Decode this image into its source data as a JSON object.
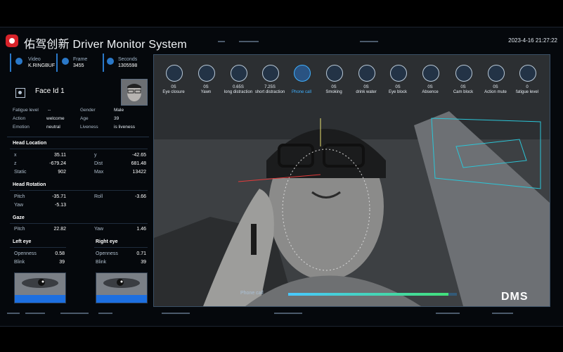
{
  "app": {
    "title": "佑驾创新 Driver  Monitor  System",
    "datetime": "2023-4-16 21:27:22"
  },
  "header": {
    "video_label": "Video",
    "video_value": "K.RINGBUF",
    "frame_label": "Frame",
    "frame_value": "3455",
    "seconds_label": "Seconds",
    "seconds_value": "1305598"
  },
  "face": {
    "title": "Face Id  1",
    "fields": [
      {
        "label": "Fatigue level",
        "value": "--"
      },
      {
        "label": "Action",
        "value": "welcome"
      },
      {
        "label": "Emotion",
        "value": "neutral"
      },
      {
        "label": "Gender",
        "value": "Male"
      },
      {
        "label": "Age",
        "value": "39"
      },
      {
        "label": "Liveness",
        "value": "is liveness"
      }
    ]
  },
  "head_location": {
    "title": "Head Location",
    "x_label": "x",
    "x": "35.11",
    "y_label": "y",
    "y": "-42.65",
    "z_label": "z",
    "z": "-679.24",
    "dist_label": "Dist",
    "dist": "681.48",
    "static_label": "Static",
    "static": "902",
    "max_label": "Max",
    "max": "13422"
  },
  "head_rotation": {
    "title": "Head Rotation",
    "pitch_label": "Pitch",
    "pitch": "-35.71",
    "roll_label": "Roll",
    "roll": "-3.66",
    "yaw_label": "Yaw",
    "yaw": "-5.13"
  },
  "gaze": {
    "title": "Gaze",
    "pitch_label": "Pitch",
    "pitch": "22.82",
    "yaw_label": "Yaw",
    "yaw": "1.46"
  },
  "left_eye": {
    "title": "Left eye",
    "openness_label": "Openness",
    "openness": "0.58",
    "blink_label": "Blink",
    "blink": "39"
  },
  "right_eye": {
    "title": "Right eye",
    "openness_label": "Openness",
    "openness": "0.71",
    "blink_label": "Blink",
    "blink": "39"
  },
  "detectors": [
    {
      "value": "0S",
      "label": "Eye closure",
      "icon": "eye-closure-icon",
      "active": false
    },
    {
      "value": "0S",
      "label": "Yawn",
      "icon": "yawn-icon",
      "active": false
    },
    {
      "value": "0.65S",
      "label": "long distraction",
      "icon": "long-distraction-icon",
      "active": false
    },
    {
      "value": "7.25S",
      "label": "short distraction",
      "icon": "short-distraction-icon",
      "active": false
    },
    {
      "value": "",
      "label": "Phone call",
      "icon": "phone-icon",
      "active": true
    },
    {
      "value": "0S",
      "label": "Smoking",
      "icon": "smoking-icon",
      "active": false
    },
    {
      "value": "0S",
      "label": "drink water",
      "icon": "drink-icon",
      "active": false
    },
    {
      "value": "0S",
      "label": "Eye block",
      "icon": "eye-block-icon",
      "active": false
    },
    {
      "value": "0S",
      "label": "Absence",
      "icon": "absence-icon",
      "active": false
    },
    {
      "value": "0S",
      "label": "Cam block",
      "icon": "cam-block-icon",
      "active": false
    },
    {
      "value": "0S",
      "label": "Action mute",
      "icon": "action-mute-icon",
      "active": false
    },
    {
      "value": "0",
      "label": "fatigue level",
      "icon": "fatigue-icon",
      "active": false
    }
  ],
  "status_bar": {
    "label": "Phone call",
    "progress": 0.95
  },
  "badge": "DMS"
}
